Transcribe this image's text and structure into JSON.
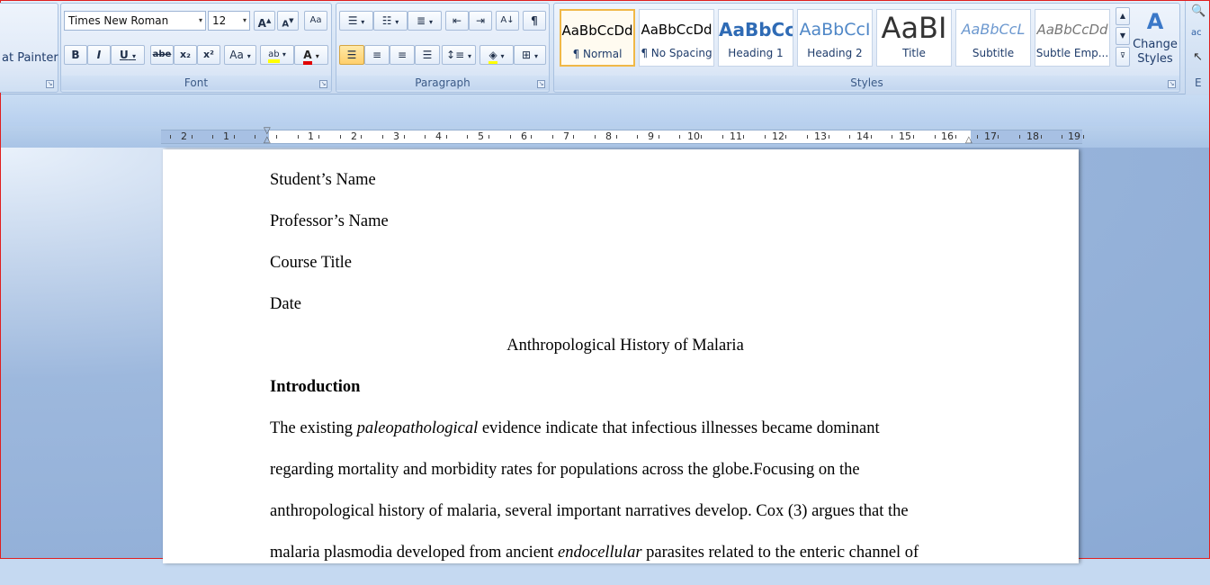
{
  "clipboard": {
    "format_painter_label": "at Painter"
  },
  "font": {
    "family": "Times New Roman",
    "size": "12",
    "grow_label": "A",
    "shrink_label": "A",
    "clear_label": "Aa",
    "bold_label": "B",
    "italic_label": "I",
    "underline_label": "U",
    "strike_label": "abe",
    "subscript_label": "x₂",
    "superscript_label": "x²",
    "case_label": "Aa",
    "highlight_label": "ab",
    "color_label": "A",
    "group_label": "Font"
  },
  "paragraph": {
    "group_label": "Paragraph",
    "pilcrow": "¶"
  },
  "styles": {
    "group_label": "Styles",
    "change_styles_label_1": "Change",
    "change_styles_label_2": "Styles",
    "items": [
      {
        "sample": "AaBbCcDd",
        "name": "¶ Normal"
      },
      {
        "sample": "AaBbCcDd",
        "name": "¶ No Spacing"
      },
      {
        "sample": "AaBbCc",
        "name": "Heading 1"
      },
      {
        "sample": "AaBbCcI",
        "name": "Heading 2"
      },
      {
        "sample": "AaBI",
        "name": "Title"
      },
      {
        "sample": "AaBbCcL",
        "name": "Subtitle"
      },
      {
        "sample": "AaBbCcDd",
        "name": "Subtle Emp..."
      }
    ]
  },
  "editing": {
    "group_label": "E"
  },
  "ruler": {
    "numbers": [
      "2",
      "1",
      "1",
      "1",
      "2",
      "3",
      "4",
      "5",
      "6",
      "7",
      "8",
      "9",
      "10",
      "11",
      "12",
      "13",
      "14",
      "15",
      "16",
      "17",
      "18",
      "19"
    ]
  },
  "document": {
    "lines": [
      {
        "text": "Student’s Name"
      },
      {
        "text": "Professor’s Name"
      },
      {
        "text": "Course Title"
      },
      {
        "text": "Date"
      },
      {
        "text": "Anthropological History of Malaria"
      },
      {
        "text": "Introduction"
      }
    ],
    "para1_a": "The existing ",
    "para1_b": "paleopathological",
    "para1_c": " evidence indicate that infectious illnesses became dominant",
    "para2": "regarding mortality and morbidity rates for populations across the globe.Focusing on the",
    "para3": "anthropological history of malaria, several important narratives develop. Cox (3) argues that the",
    "para4_a": "malaria plasmodia developed from ancient ",
    "para4_b": "endocellular",
    "para4_c": " parasites related to the enteric channel of"
  },
  "colors": {
    "ribbon_bg": "#dfe9f7",
    "workspace_bg": "#8aa9d4",
    "accent_selected": "#f0b847"
  }
}
